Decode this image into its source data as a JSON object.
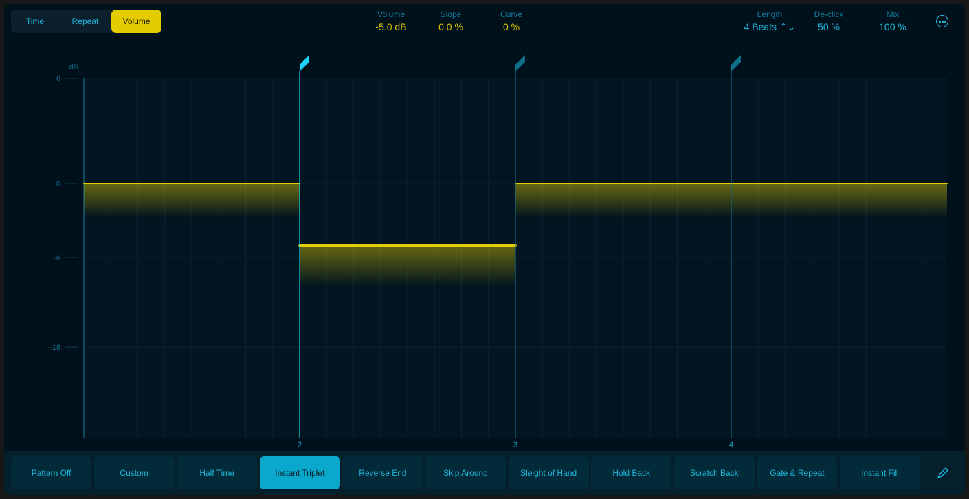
{
  "modes": {
    "items": [
      "Time",
      "Repeat",
      "Volume"
    ],
    "active": 2
  },
  "params": [
    {
      "label": "Volume",
      "value": "-5.0 dB",
      "color": "yellow"
    },
    {
      "label": "Slope",
      "value": "0.0 %",
      "color": "yellow"
    },
    {
      "label": "Curve",
      "value": "0 %",
      "color": "yellow"
    },
    {
      "label": "Length",
      "value": "4 Beats ⌃⌄",
      "color": "cyan"
    },
    {
      "label": "De-click",
      "value": "50 %",
      "color": "cyan"
    },
    {
      "label": "Mix",
      "value": "100 %",
      "color": "cyan"
    }
  ],
  "more_icon": "ellipsis-circle-icon",
  "chart_data": {
    "type": "step",
    "ylabel": "dB",
    "yticks": [
      {
        "value": 6,
        "label": "6"
      },
      {
        "value": 0,
        "label": "0"
      },
      {
        "value": -6,
        "label": "-6"
      },
      {
        "value": -18,
        "label": "-18"
      }
    ],
    "xticks": [
      {
        "beat": 2,
        "label": "2"
      },
      {
        "beat": 3,
        "label": "3"
      },
      {
        "beat": 4,
        "label": "4"
      }
    ],
    "xrange": [
      1,
      5
    ],
    "subdivisions_per_beat": 8,
    "segments": [
      {
        "start": 1,
        "end": 2,
        "db": 0
      },
      {
        "start": 2,
        "end": 3,
        "db": -5,
        "selected": true
      },
      {
        "start": 3,
        "end": 5,
        "db": 0
      }
    ],
    "colors": {
      "line": "#e3cd00",
      "marker": "#1ad4f7",
      "grid": "#0a2230"
    }
  },
  "patterns": {
    "items": [
      "Pattern Off",
      "Custom",
      "Half Time",
      "Instant Triplet",
      "Reverse End",
      "Skip Around",
      "Sleight of Hand",
      "Hold Back",
      "Scratch Back",
      "Gate & Repeat",
      "Instant Fill"
    ],
    "active": 3
  },
  "pencil_icon": "pencil-icon"
}
